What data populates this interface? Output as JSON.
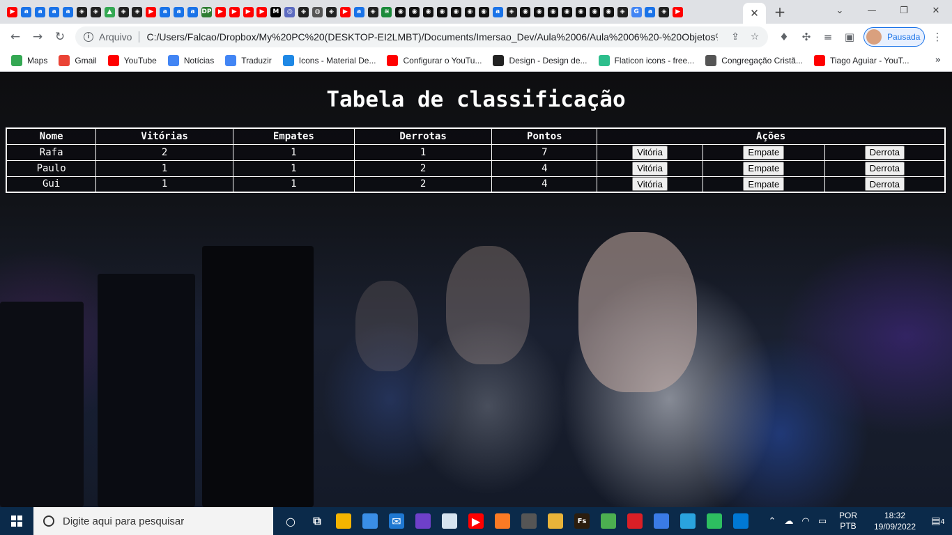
{
  "browser": {
    "tabs": {
      "favicons": [
        "youtube",
        "amazon",
        "amazon",
        "amazon",
        "amazon",
        "codepen",
        "codepen",
        "drive",
        "codepen",
        "codepen",
        "youtube",
        "amazon",
        "amazon",
        "amazon",
        "dp",
        "youtube",
        "youtube",
        "youtube",
        "youtube",
        "medium",
        "kanban",
        "codepen",
        "web",
        "codepen",
        "youtube",
        "amazon",
        "codepen",
        "books",
        "github",
        "github",
        "github",
        "github",
        "github",
        "github",
        "github",
        "amazon",
        "codepen",
        "github",
        "github",
        "github",
        "github",
        "github",
        "github",
        "github",
        "codepen",
        "google",
        "amazon",
        "codepen",
        "youtube"
      ],
      "close_glyph": "✕",
      "new_tab": "+"
    },
    "window_controls": {
      "minimize": "—",
      "restore": "❐",
      "close": "✕"
    },
    "address_bar": {
      "scheme_label": "Arquivo",
      "url": "C:/Users/Falcao/Dropbox/My%20PC%20(DESKTOP-EI2LMBT)/Documents/Imersao_Dev/Aula%2006/Aula%2006%20-%20Objetos%20..."
    },
    "profile": {
      "status": "Pausada"
    },
    "bookmarks": [
      {
        "label": "Maps",
        "icon": "maps-icon",
        "color": "#34a853"
      },
      {
        "label": "Gmail",
        "icon": "gmail-icon",
        "color": "#ea4335"
      },
      {
        "label": "YouTube",
        "icon": "youtube-icon",
        "color": "#ff0000"
      },
      {
        "label": "Notícias",
        "icon": "news-icon",
        "color": "#4285f4"
      },
      {
        "label": "Traduzir",
        "icon": "translate-icon",
        "color": "#4285f4"
      },
      {
        "label": "Icons - Material De...",
        "icon": "material-icon",
        "color": "#1e88e5"
      },
      {
        "label": "Configurar o YouTu...",
        "icon": "youtube-icon",
        "color": "#ff0000"
      },
      {
        "label": "Design - Design de...",
        "icon": "design-icon",
        "color": "#222222"
      },
      {
        "label": "Flaticon icons - free...",
        "icon": "flaticon-icon",
        "color": "#2dbe8c"
      },
      {
        "label": "Congregação Cristã...",
        "icon": "globe-icon",
        "color": "#555555"
      },
      {
        "label": "Tiago Aguiar - YouT...",
        "icon": "youtube-icon",
        "color": "#ff0000"
      }
    ],
    "more_bookmarks": "»"
  },
  "page": {
    "title": "Tabela de classificação",
    "table": {
      "headers": [
        "Nome",
        "Vitórias",
        "Empates",
        "Derrotas",
        "Pontos",
        "Ações"
      ],
      "rows": [
        {
          "nome": "Rafa",
          "vitorias": "2",
          "empates": "1",
          "derrotas": "1",
          "pontos": "7"
        },
        {
          "nome": "Paulo",
          "vitorias": "1",
          "empates": "1",
          "derrotas": "2",
          "pontos": "4"
        },
        {
          "nome": "Gui",
          "vitorias": "1",
          "empates": "1",
          "derrotas": "2",
          "pontos": "4"
        }
      ],
      "actions": {
        "win": "Vitória",
        "draw": "Empate",
        "loss": "Derrota"
      }
    }
  },
  "taskbar": {
    "search_placeholder": "Digite aqui para pesquisar",
    "apps": [
      {
        "name": "cortana-icon",
        "color": "transparent",
        "glyph": "○"
      },
      {
        "name": "task-view-icon",
        "color": "transparent",
        "glyph": "⧉"
      },
      {
        "name": "file-explorer-icon",
        "color": "#f4b400",
        "glyph": ""
      },
      {
        "name": "store-icon",
        "color": "#3a8ee6",
        "glyph": ""
      },
      {
        "name": "mail-icon",
        "color": "#1f78d1",
        "glyph": "✉"
      },
      {
        "name": "github-desktop-icon",
        "color": "#6e40c9",
        "glyph": ""
      },
      {
        "name": "paint-icon",
        "color": "#d6e4f0",
        "glyph": ""
      },
      {
        "name": "youtube-icon",
        "color": "#ff0000",
        "glyph": "▶"
      },
      {
        "name": "xampp-icon",
        "color": "#fb7a24",
        "glyph": ""
      },
      {
        "name": "calculator-icon",
        "color": "#555555",
        "glyph": ""
      },
      {
        "name": "maps-app-icon",
        "color": "#e8b339",
        "glyph": ""
      },
      {
        "name": "fireworks-icon",
        "color": "#2b1d0e",
        "glyph": "Fs"
      },
      {
        "name": "3d-viewer-icon",
        "color": "#4caf50",
        "glyph": ""
      },
      {
        "name": "creative-cloud-icon",
        "color": "#da1f26",
        "glyph": ""
      },
      {
        "name": "network-app-icon",
        "color": "#3a7be6",
        "glyph": ""
      },
      {
        "name": "telegram-icon",
        "color": "#2aa3de",
        "glyph": ""
      },
      {
        "name": "evernote-icon",
        "color": "#2dbe60",
        "glyph": ""
      },
      {
        "name": "vscode-icon",
        "color": "#0078d4",
        "glyph": ""
      }
    ],
    "tray": {
      "language": "POR",
      "layout": "PTB",
      "time": "18:32",
      "date": "19/09/2022",
      "notifications": "4"
    }
  }
}
